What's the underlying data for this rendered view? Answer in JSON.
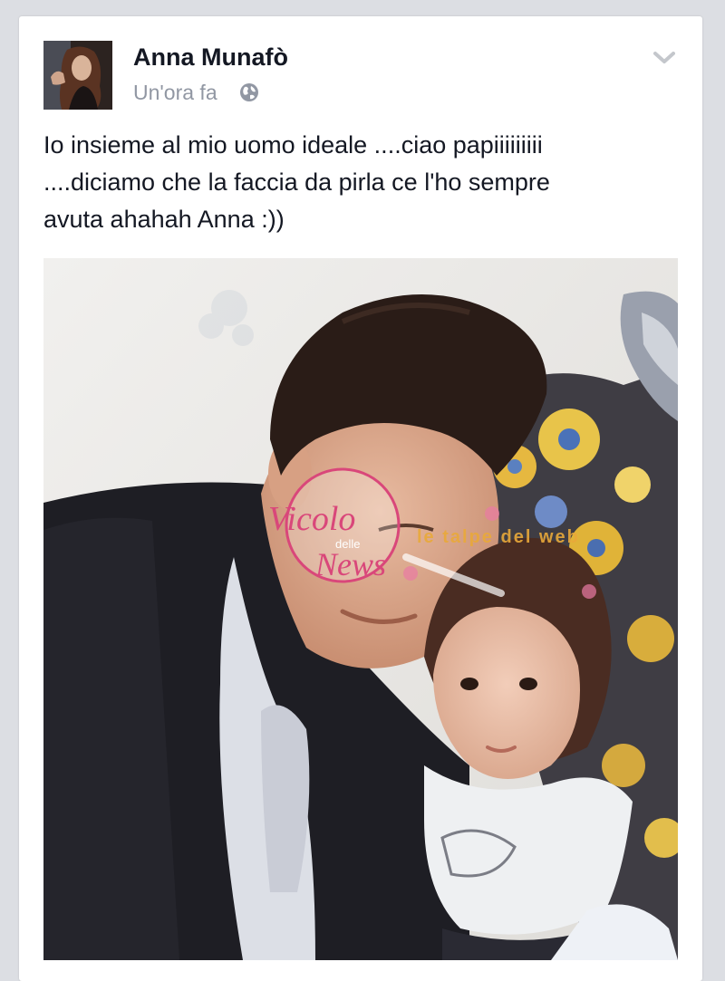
{
  "post": {
    "author": "Anna Munafò",
    "timestamp": "Un'ora fa",
    "audience_icon": "globe-icon",
    "menu_icon": "chevron-down-icon",
    "text_lines": [
      "Io insieme al mio uomo ideale ....ciao papiiiiiiiii",
      "....diciamo che la faccia da pirla ce l'ho sempre",
      "avuta ahahah Anna :))"
    ]
  },
  "watermark": {
    "logo_line1": "Vicolo",
    "logo_line2": "delle",
    "logo_line3": "News",
    "caption": "le talpe del web"
  },
  "colors": {
    "author": "#141823",
    "meta": "#9197a3",
    "watermark": "#d9477a",
    "watermark_caption": "#e9a93a"
  }
}
